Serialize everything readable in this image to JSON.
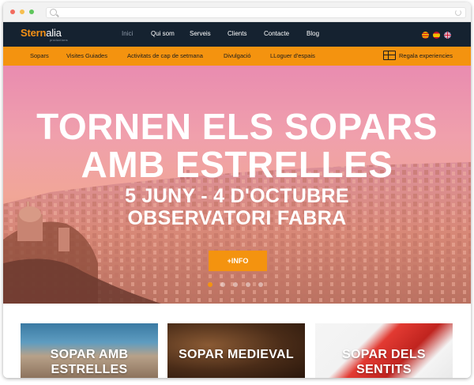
{
  "browser": {
    "dot_colors": [
      "#f26b5e",
      "#f6be4f",
      "#5fc65c"
    ]
  },
  "brand": {
    "name_part1": "Stern",
    "name_part2": "alia",
    "tagline": "productions",
    "color": "#f39015"
  },
  "nav": {
    "items": [
      {
        "label": "Inici",
        "active": true
      },
      {
        "label": "Qui som",
        "active": false
      },
      {
        "label": "Serveis",
        "active": false
      },
      {
        "label": "Clients",
        "active": false
      },
      {
        "label": "Contacte",
        "active": false
      },
      {
        "label": "Blog",
        "active": false
      }
    ],
    "languages": [
      "catalan-flag-icon",
      "spanish-flag-icon",
      "uk-flag-icon"
    ]
  },
  "subnav": {
    "items": [
      "Sopars",
      "Visites Guiades",
      "Activitats de cap de setmana",
      "Divulgació",
      "LLoguer d'espais"
    ],
    "gift_label": "Regala experiencies"
  },
  "hero": {
    "title_line1": "TORNEN ELS SOPARS",
    "title_line2": "AMB ESTRELLES",
    "subtitle_line1": "5 JUNY - 4 D'OCTUBRE",
    "subtitle_line2": "OBSERVATORI FABRA",
    "button_label": "+INFO",
    "slide_count": 5,
    "active_slide": 1
  },
  "cards": [
    {
      "title_line1": "SOPAR AMB",
      "title_line2": "ESTRELLES"
    },
    {
      "title_line1": "SOPAR MEDIEVAL",
      "title_line2": ""
    },
    {
      "title_line1": "SOPAR DELS",
      "title_line2": "SENTITS"
    }
  ],
  "colors": {
    "accent": "#f4930f",
    "nav_bg": "#152230",
    "nav_active": "#8d99a8"
  }
}
